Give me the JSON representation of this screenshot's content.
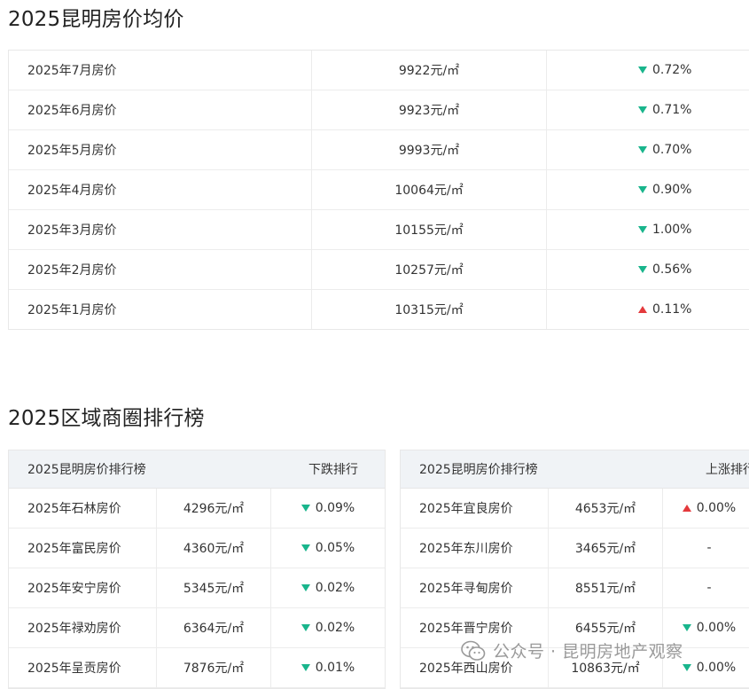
{
  "monthly": {
    "title": "2025昆明房价均价",
    "rows": [
      {
        "label": "2025年7月房价",
        "price": "9922元/㎡",
        "dir": "down",
        "change": "0.72%"
      },
      {
        "label": "2025年6月房价",
        "price": "9923元/㎡",
        "dir": "down",
        "change": "0.71%"
      },
      {
        "label": "2025年5月房价",
        "price": "9993元/㎡",
        "dir": "down",
        "change": "0.70%"
      },
      {
        "label": "2025年4月房价",
        "price": "10064元/㎡",
        "dir": "down",
        "change": "0.90%"
      },
      {
        "label": "2025年3月房价",
        "price": "10155元/㎡",
        "dir": "down",
        "change": "1.00%"
      },
      {
        "label": "2025年2月房价",
        "price": "10257元/㎡",
        "dir": "down",
        "change": "0.56%"
      },
      {
        "label": "2025年1月房价",
        "price": "10315元/㎡",
        "dir": "up",
        "change": "0.11%"
      }
    ]
  },
  "ranking": {
    "title": "2025区域商圈排行榜",
    "left": {
      "header_title": "2025昆明房价排行榜",
      "header_sort": "下跌排行",
      "rows": [
        {
          "name": "2025年石林房价",
          "price": "4296元/㎡",
          "dir": "down",
          "change": "0.09%"
        },
        {
          "name": "2025年富民房价",
          "price": "4360元/㎡",
          "dir": "down",
          "change": "0.05%"
        },
        {
          "name": "2025年安宁房价",
          "price": "5345元/㎡",
          "dir": "down",
          "change": "0.02%"
        },
        {
          "name": "2025年禄劝房价",
          "price": "6364元/㎡",
          "dir": "down",
          "change": "0.02%"
        },
        {
          "name": "2025年呈贡房价",
          "price": "7876元/㎡",
          "dir": "down",
          "change": "0.01%"
        }
      ]
    },
    "right": {
      "header_title": "2025昆明房价排行榜",
      "header_sort": "上涨排行",
      "rows": [
        {
          "name": "2025年宜良房价",
          "price": "4653元/㎡",
          "dir": "up",
          "change": "0.00%"
        },
        {
          "name": "2025年东川房价",
          "price": "3465元/㎡",
          "dir": "none",
          "change": "-"
        },
        {
          "name": "2025年寻甸房价",
          "price": "8551元/㎡",
          "dir": "none",
          "change": "-"
        },
        {
          "name": "2025年晋宁房价",
          "price": "6455元/㎡",
          "dir": "down",
          "change": "0.00%"
        },
        {
          "name": "2025年西山房价",
          "price": "10863元/㎡",
          "dir": "down",
          "change": "0.00%"
        }
      ]
    }
  },
  "watermark": {
    "text": "公众号 · 昆明房地产观察",
    "icon": "wechat-icon"
  },
  "colors": {
    "down": "#19b58c",
    "up": "#e4393c",
    "header_bg": "#f0f3f6"
  }
}
